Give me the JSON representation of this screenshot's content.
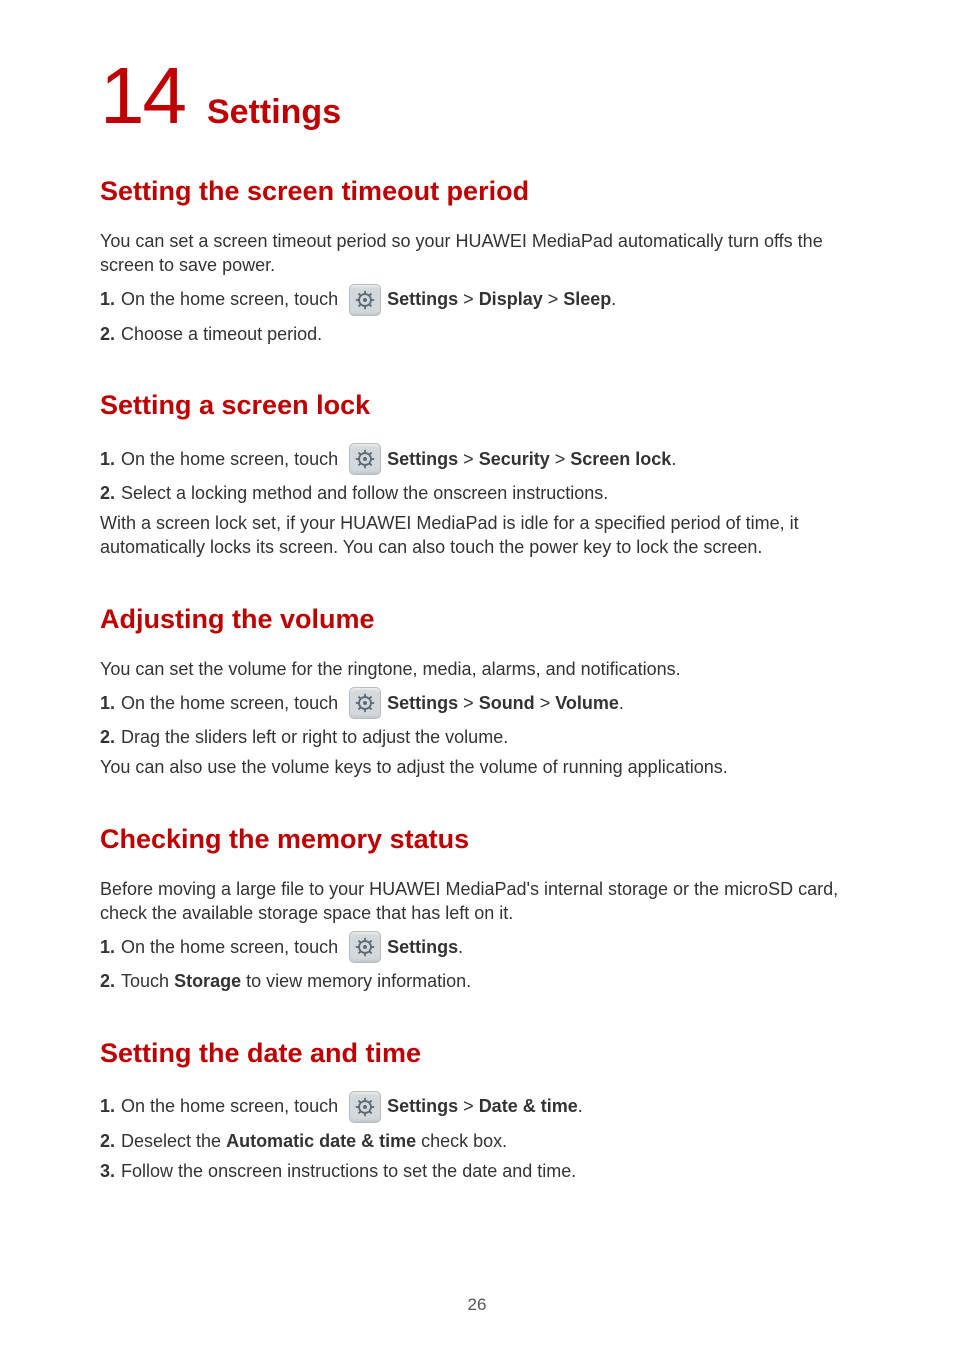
{
  "chapter": {
    "number": "14",
    "title": "Settings"
  },
  "sections": {
    "timeout": {
      "heading": "Setting the screen timeout period",
      "intro": "You can set a screen timeout period so your HUAWEI MediaPad automatically turn offs the screen to save power.",
      "step1_num": "1. ",
      "step1_a": "On the home screen, touch ",
      "step1_b": "Settings",
      "step1_c": " > ",
      "step1_d": "Display",
      "step1_e": " > ",
      "step1_f": "Sleep",
      "step1_g": ".",
      "step2_num": "2. ",
      "step2": "Choose a timeout period."
    },
    "lock": {
      "heading": "Setting a screen lock",
      "step1_num": "1. ",
      "step1_a": "On the home screen, touch ",
      "step1_b": "Settings",
      "step1_c": " > ",
      "step1_d": "Security",
      "step1_e": " > ",
      "step1_f": "Screen lock",
      "step1_g": ".",
      "step2_num": "2. ",
      "step2": "Select a locking method and follow the onscreen instructions.",
      "note": "With a screen lock set, if your HUAWEI MediaPad is idle for a specified period of time, it automatically locks its screen. You can also touch the power key to lock the screen."
    },
    "volume": {
      "heading": "Adjusting the volume",
      "intro": "You can set the volume for the ringtone, media, alarms, and notifications.",
      "step1_num": "1. ",
      "step1_a": "On the home screen, touch ",
      "step1_b": "Settings",
      "step1_c": " > ",
      "step1_d": "Sound",
      "step1_e": " > ",
      "step1_f": "Volume",
      "step1_g": ".",
      "step2_num": "2. ",
      "step2": "Drag the sliders left or right to adjust the volume.",
      "note": "You can also use the volume keys to adjust the volume of running applications."
    },
    "memory": {
      "heading": "Checking the memory status",
      "intro": "Before moving a large file to your HUAWEI MediaPad's internal storage or the microSD card, check the available storage space that has left on it.",
      "step1_num": "1. ",
      "step1_a": "On the home screen, touch ",
      "step1_b": "Settings",
      "step1_c": ".",
      "step2_num": "2. ",
      "step2_a": "Touch ",
      "step2_b": "Storage",
      "step2_c": " to view memory information."
    },
    "datetime": {
      "heading": "Setting the date and time",
      "step1_num": "1. ",
      "step1_a": "On the home screen, touch ",
      "step1_b": "Settings",
      "step1_c": " > ",
      "step1_d": "Date & time",
      "step1_e": ".",
      "step2_num": "2. ",
      "step2_a": "Deselect the ",
      "step2_b": "Automatic date & time",
      "step2_c": " check box.",
      "step3_num": "3. ",
      "step3": "Follow the onscreen instructions to set the date and time."
    }
  },
  "page_number": "26"
}
